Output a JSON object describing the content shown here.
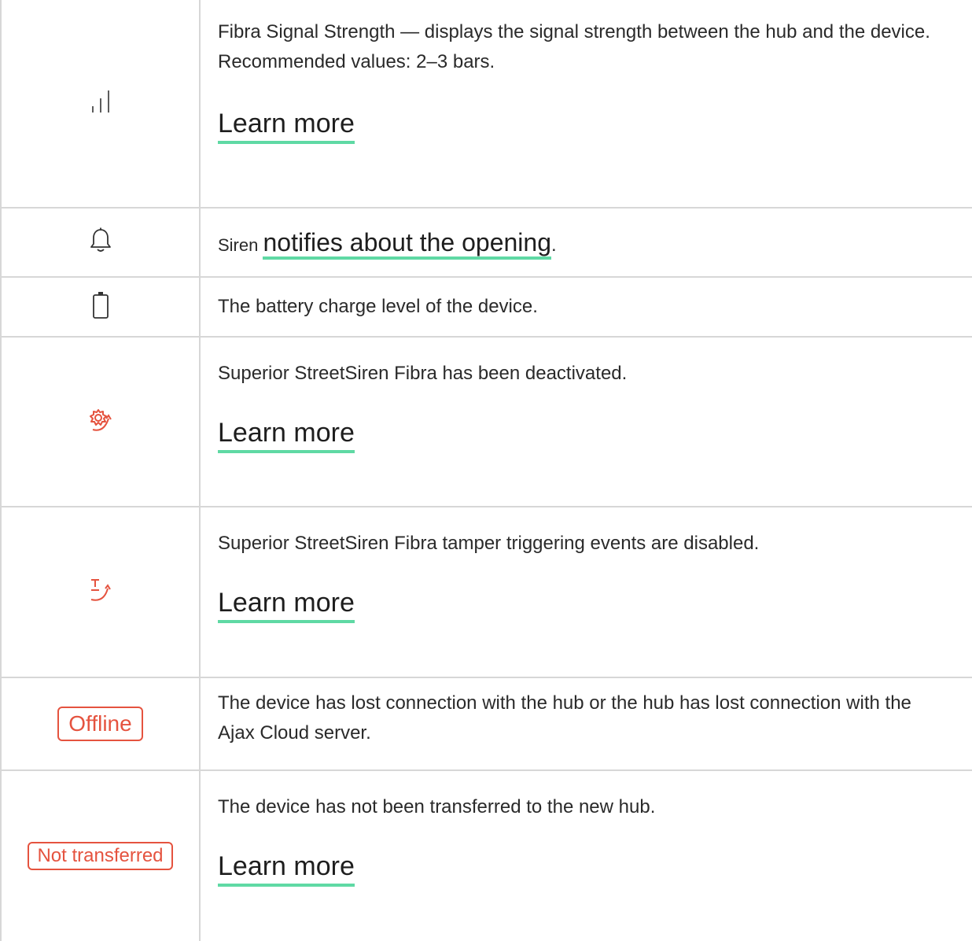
{
  "rows": [
    {
      "icon": "signal-strength-icon",
      "text": "Fibra Signal Strength — displays the signal strength between the hub and the device. Recommended values: 2–3 bars.",
      "link": "Learn more"
    },
    {
      "icon": "bell-icon",
      "prefix": "Siren ",
      "link": "notifies about the opening",
      "suffix": "."
    },
    {
      "icon": "battery-icon",
      "text": "The battery charge level of the device."
    },
    {
      "icon": "gear-deactivated-icon",
      "text": "Superior StreetSiren Fibra has been deactivated.",
      "link": "Learn more"
    },
    {
      "icon": "tamper-disabled-icon",
      "text": "Superior StreetSiren Fibra tamper triggering events are disabled.",
      "link": "Learn more"
    },
    {
      "badge": "Offline",
      "text": "The device has lost connection with the hub or the hub has lost connection with the Ajax Cloud server."
    },
    {
      "badge": "Not transferred",
      "text": "The device has not been transferred to the new hub.",
      "link": "Learn more"
    }
  ],
  "colors": {
    "accent_underline": "#5fd9a4",
    "status_red": "#e5533f",
    "border": "#d7d7d7"
  }
}
